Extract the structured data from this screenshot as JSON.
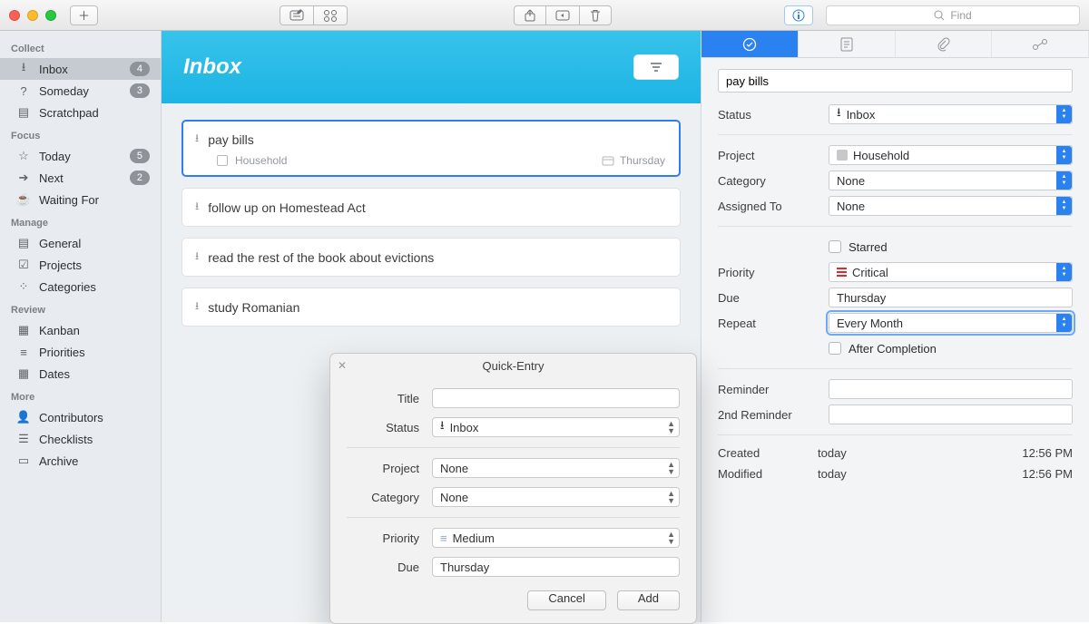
{
  "toolbar": {
    "search_placeholder": "Find"
  },
  "sidebar": {
    "sections": [
      {
        "header": "Collect",
        "items": [
          {
            "icon": "inbox-icon",
            "label": "Inbox",
            "badge": "4",
            "selected": true
          },
          {
            "icon": "someday-icon",
            "label": "Someday",
            "badge": "3"
          },
          {
            "icon": "scratchpad-icon",
            "label": "Scratchpad"
          }
        ]
      },
      {
        "header": "Focus",
        "items": [
          {
            "icon": "star-icon",
            "label": "Today",
            "badge": "5"
          },
          {
            "icon": "next-icon",
            "label": "Next",
            "badge": "2"
          },
          {
            "icon": "waiting-icon",
            "label": "Waiting For"
          }
        ]
      },
      {
        "header": "Manage",
        "items": [
          {
            "icon": "general-icon",
            "label": "General"
          },
          {
            "icon": "projects-icon",
            "label": "Projects"
          },
          {
            "icon": "categories-icon",
            "label": "Categories"
          }
        ]
      },
      {
        "header": "Review",
        "items": [
          {
            "icon": "kanban-icon",
            "label": "Kanban"
          },
          {
            "icon": "priorities-icon",
            "label": "Priorities"
          },
          {
            "icon": "dates-icon",
            "label": "Dates"
          }
        ]
      },
      {
        "header": "More",
        "items": [
          {
            "icon": "contributors-icon",
            "label": "Contributors"
          },
          {
            "icon": "checklists-icon",
            "label": "Checklists"
          },
          {
            "icon": "archive-icon",
            "label": "Archive"
          }
        ]
      }
    ]
  },
  "center": {
    "title": "Inbox",
    "tasks": [
      {
        "title": "pay bills",
        "selected": true,
        "project": "Household",
        "due": "Thursday"
      },
      {
        "title": "follow up on Homestead Act"
      },
      {
        "title": "read the rest of the book about evictions"
      },
      {
        "title": "study Romanian"
      }
    ]
  },
  "quick_entry": {
    "window_title": "Quick-Entry",
    "labels": {
      "title": "Title",
      "status": "Status",
      "project": "Project",
      "category": "Category",
      "priority": "Priority",
      "due": "Due"
    },
    "values": {
      "title": "",
      "status": "Inbox",
      "project": "None",
      "category": "None",
      "priority": "Medium",
      "due": "Thursday"
    },
    "buttons": {
      "cancel": "Cancel",
      "add": "Add"
    }
  },
  "inspector": {
    "title_value": "pay bills",
    "labels": {
      "status": "Status",
      "project": "Project",
      "category": "Category",
      "assigned_to": "Assigned To",
      "starred": "Starred",
      "priority": "Priority",
      "due": "Due",
      "repeat": "Repeat",
      "after_completion": "After Completion",
      "reminder": "Reminder",
      "reminder2": "2nd Reminder",
      "created": "Created",
      "modified": "Modified"
    },
    "values": {
      "status": "Inbox",
      "project": "Household",
      "category": "None",
      "assigned_to": "None",
      "priority": "Critical",
      "due": "Thursday",
      "repeat": "Every Month",
      "reminder": "",
      "reminder2": "",
      "created_date": "today",
      "created_time": "12:56 PM",
      "modified_date": "today",
      "modified_time": "12:56 PM"
    }
  }
}
